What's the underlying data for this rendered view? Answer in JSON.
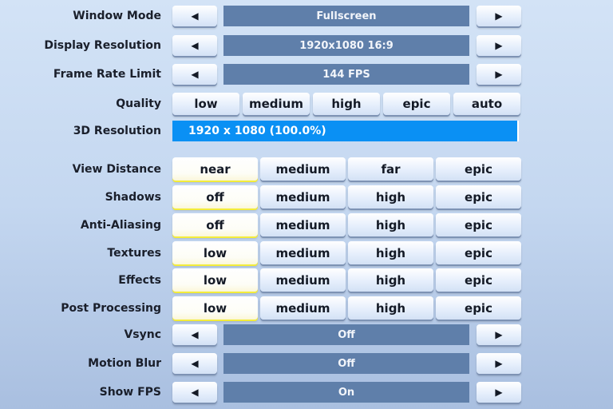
{
  "selectors_top": [
    {
      "id": "window-mode",
      "label": "Window Mode",
      "value": "Fullscreen"
    },
    {
      "id": "display-resolution",
      "label": "Display Resolution",
      "value": "1920x1080 16:9"
    },
    {
      "id": "frame-rate-limit",
      "label": "Frame Rate Limit",
      "value": "144 FPS"
    }
  ],
  "quality": {
    "label": "Quality",
    "options": [
      "low",
      "medium",
      "high",
      "epic",
      "auto"
    ]
  },
  "resolution_3d": {
    "label": "3D Resolution",
    "value": "1920 x 1080 (100.0%)",
    "percent": 100
  },
  "option_rows": [
    {
      "id": "view-distance",
      "label": "View Distance",
      "options": [
        "near",
        "medium",
        "far",
        "epic"
      ],
      "selected": 0
    },
    {
      "id": "shadows",
      "label": "Shadows",
      "options": [
        "off",
        "medium",
        "high",
        "epic"
      ],
      "selected": 0
    },
    {
      "id": "anti-aliasing",
      "label": "Anti-Aliasing",
      "options": [
        "off",
        "medium",
        "high",
        "epic"
      ],
      "selected": 0
    },
    {
      "id": "textures",
      "label": "Textures",
      "options": [
        "low",
        "medium",
        "high",
        "epic"
      ],
      "selected": 0
    },
    {
      "id": "effects",
      "label": "Effects",
      "options": [
        "low",
        "medium",
        "high",
        "epic"
      ],
      "selected": 0
    },
    {
      "id": "post-processing",
      "label": "Post Processing",
      "options": [
        "low",
        "medium",
        "high",
        "epic"
      ],
      "selected": 0
    }
  ],
  "selectors_bottom": [
    {
      "id": "vsync",
      "label": "Vsync",
      "value": "Off"
    },
    {
      "id": "motion-blur",
      "label": "Motion Blur",
      "value": "Off"
    },
    {
      "id": "show-fps",
      "label": "Show FPS",
      "value": "On"
    }
  ],
  "icons": {
    "left": "◀",
    "right": "▶"
  },
  "colors": {
    "accent": "#0a90f4",
    "value_bar": "#5f7faa",
    "selected_underline": "#f3ec3a"
  }
}
